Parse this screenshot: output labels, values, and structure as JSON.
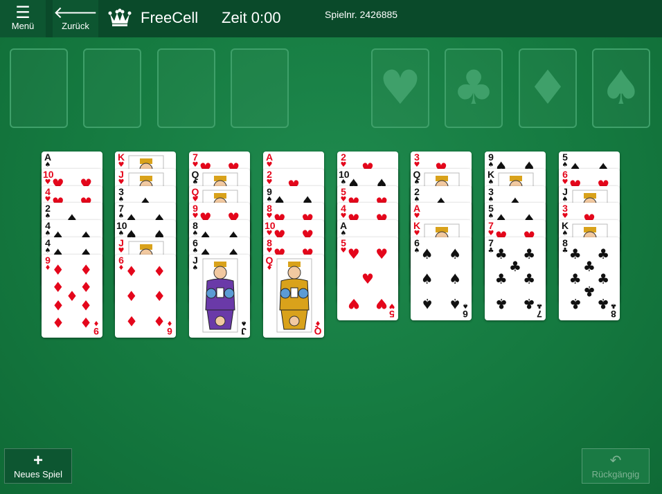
{
  "header": {
    "menu_label": "Menü",
    "back_label": "Zurück",
    "title": "FreeCell",
    "timer": "Zeit 0:00",
    "game_number": "Spielnr. 2426885"
  },
  "foundations": [
    "heart",
    "club",
    "diamond",
    "spade"
  ],
  "tableau": [
    [
      [
        "A",
        "spade"
      ],
      [
        "10",
        "heart"
      ],
      [
        "4",
        "heart"
      ],
      [
        "2",
        "spade"
      ],
      [
        "4",
        "spade"
      ],
      [
        "4",
        "spade"
      ],
      [
        "9",
        "diamond"
      ]
    ],
    [
      [
        "K",
        "heart"
      ],
      [
        "J",
        "heart"
      ],
      [
        "3",
        "spade"
      ],
      [
        "7",
        "spade"
      ],
      [
        "10",
        "spade"
      ],
      [
        "J",
        "heart"
      ],
      [
        "6",
        "diamond"
      ]
    ],
    [
      [
        "7",
        "heart"
      ],
      [
        "Q",
        "spade"
      ],
      [
        "Q",
        "heart"
      ],
      [
        "9",
        "heart"
      ],
      [
        "8",
        "spade"
      ],
      [
        "6",
        "spade"
      ],
      [
        "J",
        "spade"
      ]
    ],
    [
      [
        "A",
        "heart"
      ],
      [
        "2",
        "heart"
      ],
      [
        "9",
        "spade"
      ],
      [
        "8",
        "heart"
      ],
      [
        "10",
        "heart"
      ],
      [
        "8",
        "heart"
      ],
      [
        "Q",
        "diamond"
      ]
    ],
    [
      [
        "2",
        "heart"
      ],
      [
        "10",
        "spade"
      ],
      [
        "5",
        "heart"
      ],
      [
        "4",
        "heart"
      ],
      [
        "A",
        "spade"
      ],
      [
        "5",
        "heart"
      ]
    ],
    [
      [
        "3",
        "heart"
      ],
      [
        "Q",
        "spade"
      ],
      [
        "2",
        "spade"
      ],
      [
        "A",
        "heart"
      ],
      [
        "K",
        "heart"
      ],
      [
        "6",
        "spade"
      ]
    ],
    [
      [
        "9",
        "spade"
      ],
      [
        "K",
        "spade"
      ],
      [
        "3",
        "spade"
      ],
      [
        "5",
        "spade"
      ],
      [
        "7",
        "heart"
      ],
      [
        "7",
        "club"
      ]
    ],
    [
      [
        "5",
        "spade"
      ],
      [
        "6",
        "heart"
      ],
      [
        "J",
        "spade"
      ],
      [
        "3",
        "heart"
      ],
      [
        "K",
        "spade"
      ],
      [
        "8",
        "club"
      ]
    ]
  ],
  "footer": {
    "new_game_label": "Neues Spiel",
    "undo_label": "Rückgängig"
  }
}
